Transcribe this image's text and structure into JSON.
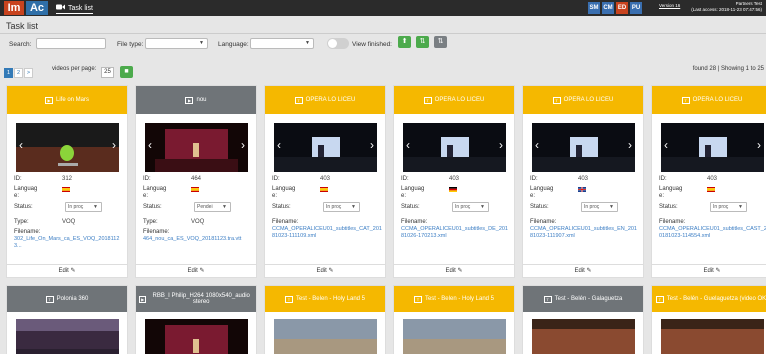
{
  "header": {
    "logo_left": "Im",
    "logo_right": "Ac",
    "nav_tab": "Task list",
    "languages": [
      {
        "code": "SM",
        "color": "#3a6fb0"
      },
      {
        "code": "CM",
        "color": "#3a6fb0"
      },
      {
        "code": "ED",
        "color": "#c8431e"
      },
      {
        "code": "PU",
        "color": "#3a6fb0"
      }
    ],
    "version": "Version 16",
    "user_name": "Partners Test",
    "last_access": "(Last access: 2018-11-23 07:47:56)"
  },
  "page": {
    "title": "Task list"
  },
  "filters": {
    "search_label": "Search:",
    "search_value": "",
    "file_type_label": "File type:",
    "file_type_value": "",
    "language_label": "Language:",
    "language_value": "",
    "view_finished_label": "View finished:",
    "view_finished_on": false
  },
  "pagination": {
    "pages": [
      "1",
      "2",
      ">"
    ],
    "active_page": "1",
    "videos_per_page_label": "videos per page:",
    "videos_per_page": "25",
    "found_text": "found 28 | Showing 1 to 25"
  },
  "labels": {
    "id": "ID:",
    "language_line1": "Languag",
    "language_line2": "e:",
    "status": "Status:",
    "type": "Type:",
    "filename": "Filename:",
    "edit": "Edit"
  },
  "cards": [
    {
      "title": "Life on Mars",
      "header_color": "yellow",
      "icon": "video-icon",
      "id": "312",
      "language_flag": "es",
      "status": "In proç",
      "type": "VOQ",
      "filename": "302_Life_On_Mars_ca_ES_VOQ_20181123...",
      "thumb": "mars"
    },
    {
      "title": "nou",
      "header_color": "grey",
      "icon": "video-icon",
      "id": "464",
      "language_flag": "es",
      "status": "Pendei",
      "type": "VOQ",
      "filename": "464_nou_ca_ES_VOQ_20181123.tra.vtt",
      "thumb": "stage"
    },
    {
      "title": "OPERA LO LICEU",
      "header_color": "yellow",
      "icon": "subtitle-icon",
      "id": "403",
      "language_flag": "es",
      "status": "In proç",
      "type": "",
      "filename": "CCMA_OPERALICEU01_subtitles_CAT_20181023-111109.xml",
      "thumb": "opera"
    },
    {
      "title": "OPERA LO LICEU",
      "header_color": "yellow",
      "icon": "subtitle-icon",
      "id": "403",
      "language_flag": "de",
      "status": "In proç",
      "type": "",
      "filename": "CCMA_OPERALICEU01_subtitles_DE_20181026-170213.xml",
      "thumb": "opera"
    },
    {
      "title": "OPERA LO LICEU",
      "header_color": "yellow",
      "icon": "subtitle-icon",
      "id": "403",
      "language_flag": "gb",
      "status": "In proç",
      "type": "",
      "filename": "CCMA_OPERALICEU01_subtitles_EN_20181023-111907.xml",
      "thumb": "opera"
    },
    {
      "title": "OPERA LO LICEU",
      "header_color": "yellow",
      "icon": "subtitle-icon",
      "id": "403",
      "language_flag": "es",
      "status": "In proç",
      "type": "",
      "filename": "CCMA_OPERALICEU01_subtitles_CAST_20181023-114554.xml",
      "thumb": "opera"
    }
  ],
  "cards_row2": [
    {
      "title": "Polonia 360",
      "header_color": "grey",
      "icon": "subtitle-icon",
      "thumb": "polonia"
    },
    {
      "title": "RBB_I Philip_H264 1080x540_audio stereo",
      "header_color": "grey",
      "icon": "video-icon",
      "thumb": "stage"
    },
    {
      "title": "Test - Belen - Holy Land 5",
      "header_color": "yellow",
      "icon": "subtitle-icon",
      "thumb": "holy"
    },
    {
      "title": "Test - Belen - Holy Land 5",
      "header_color": "yellow",
      "icon": "subtitle-icon",
      "thumb": "holy"
    },
    {
      "title": "Test - Belén - Galaguetza",
      "header_color": "grey",
      "icon": "subtitle-icon",
      "thumb": "galaguetza"
    },
    {
      "title": "Test - Belén - Guelaguetza (video OK)",
      "header_color": "yellow",
      "icon": "subtitle-icon",
      "thumb": "galaguetza"
    }
  ]
}
